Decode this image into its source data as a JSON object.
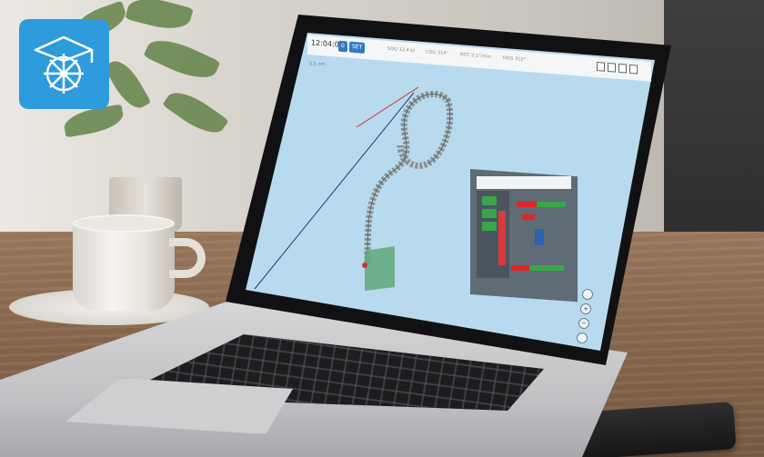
{
  "screen": {
    "toolbar": {
      "clock": "12:04:02",
      "button_a": "0",
      "button_b": "SET",
      "stats": [
        "SOG 12.4 kt",
        "COG 314°",
        "ROT 2.1°/min",
        "HDG 312°"
      ]
    },
    "scale_label": "0.5 nm"
  },
  "colors": {
    "logo_bg": "#2e9bdc",
    "screen_bg": "#b8daef",
    "track_line": "#1f3b73",
    "bearing_line": "#d23030",
    "panel_bg": "#5f6b75",
    "bar_red": "#e02424",
    "bar_green": "#3aa64a"
  },
  "icons": [
    "graduation-cap-icon",
    "ship-wheel-icon",
    "map-zoom-in-icon",
    "map-zoom-out-icon"
  ]
}
